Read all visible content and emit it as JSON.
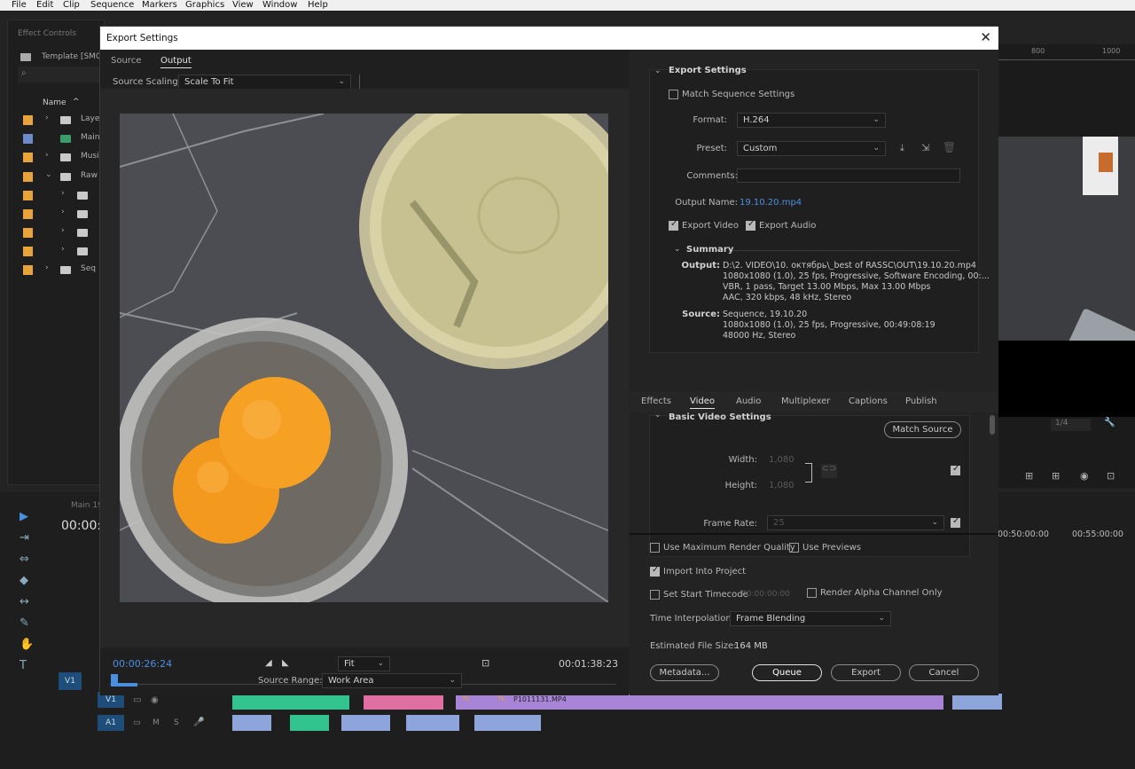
{
  "menu": [
    "File",
    "Edit",
    "Clip",
    "Sequence",
    "Markers",
    "Graphics",
    "View",
    "Window",
    "Help"
  ],
  "bg_panels": {
    "effect_controls_tab": "Effect Controls",
    "project_template": "Template [SMC",
    "name_header": "Name",
    "project_items": [
      "Laye",
      "Main",
      "Musi",
      "Raw",
      "",
      "",
      "",
      "",
      "Seq"
    ],
    "timeline_seq": "Main 19",
    "timeline_time": "00:00:",
    "v1_track": "V1",
    "a1_track": "A1",
    "v1_target": "V1",
    "ruler_labels": [
      "800",
      "1000"
    ],
    "timecode_right1": "00:50:00:00",
    "timecode_right2": "00:55:00:00",
    "zoom_label": "1/4",
    "clip_name": "P1011131.MP4"
  },
  "dialog": {
    "title": "Export Settings",
    "tabs": [
      "Source",
      "Output"
    ],
    "active_tab": "Output",
    "source_scaling_label": "Source Scaling:",
    "source_scaling_value": "Scale To Fit",
    "current_time": "00:00:26:24",
    "duration": "00:01:38:23",
    "fit_value": "Fit",
    "source_range_label": "Source Range:",
    "source_range_value": "Work Area",
    "export_settings": {
      "section_title": "Export Settings",
      "match_sequence_label": "Match Sequence Settings",
      "match_sequence_checked": false,
      "format_label": "Format:",
      "format_value": "H.264",
      "preset_label": "Preset:",
      "preset_value": "Custom",
      "comments_label": "Comments:",
      "comments_value": "",
      "output_name_label": "Output Name:",
      "output_name_value": "19.10.20.mp4",
      "export_video_label": "Export Video",
      "export_audio_label": "Export Audio",
      "summary_title": "Summary",
      "output_label": "Output:",
      "output_lines": [
        "D:\\2. VIDEO\\10. октябрь\\_best of RASSC\\OUT\\19.10.20.mp4",
        "1080x1080 (1.0), 25 fps, Progressive, Software Encoding, 00:...",
        "VBR, 1 pass, Target 13.00 Mbps, Max 13.00 Mbps",
        "AAC, 320 kbps, 48 kHz, Stereo"
      ],
      "source_label": "Source:",
      "source_lines": [
        "Sequence, 19.10.20",
        "1080x1080 (1.0), 25 fps, Progressive, 00:49:08:19",
        "48000 Hz, Stereo"
      ]
    },
    "subtabs": [
      "Effects",
      "Video",
      "Audio",
      "Multiplexer",
      "Captions",
      "Publish"
    ],
    "active_subtab": "Video",
    "basic_video": {
      "title": "Basic Video Settings",
      "match_source_label": "Match Source",
      "width_label": "Width:",
      "width_value": "1,080",
      "height_label": "Height:",
      "height_value": "1,080",
      "frame_rate_label": "Frame Rate:",
      "frame_rate_value": "25"
    },
    "options": {
      "max_render_label": "Use Maximum Render Quality",
      "use_previews_label": "Use Previews",
      "import_project_label": "Import Into Project",
      "set_start_tc_label": "Set Start Timecode",
      "start_tc_value": "00:00:00:00",
      "render_alpha_label": "Render Alpha Channel Only",
      "time_interp_label": "Time Interpolation:",
      "time_interp_value": "Frame Blending",
      "est_size_label": "Estimated File Size:",
      "est_size_value": "164 MB"
    },
    "buttons": {
      "metadata": "Metadata...",
      "queue": "Queue",
      "export": "Export",
      "cancel": "Cancel"
    }
  }
}
